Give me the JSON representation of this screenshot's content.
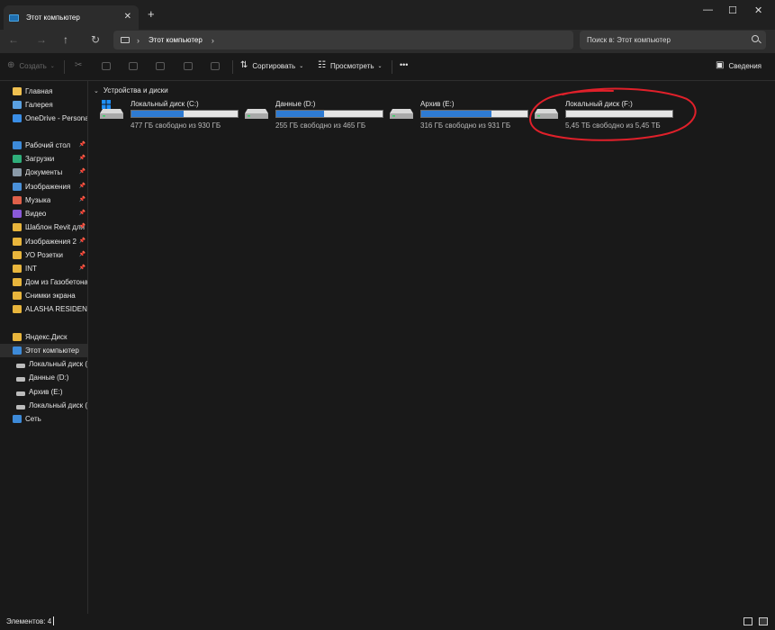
{
  "window": {
    "tab_title": "Этот компьютер",
    "close_tab": "✕",
    "new_tab": "+",
    "minimize": "—",
    "maximize": "☐",
    "close": "✕"
  },
  "address": {
    "back": "←",
    "forward": "→",
    "up": "↑",
    "refresh": "↻",
    "path": "Этот компьютер",
    "search_placeholder": "Поиск в: Этот компьютер"
  },
  "toolbar": {
    "create": "Создать",
    "sort": "Сортировать",
    "view": "Просмотреть",
    "more": "•••",
    "details": "Сведения"
  },
  "sidebar": {
    "items": [
      {
        "label": "Главная",
        "icon": "home-icon",
        "color": "#f0c050",
        "pinned": false
      },
      {
        "label": "Галерея",
        "icon": "gallery-icon",
        "color": "#5aa0e0",
        "pinned": false
      },
      {
        "label": "OneDrive - Personal",
        "icon": "cloud-icon",
        "color": "#3a8ee6",
        "pinned": false
      },
      {
        "label": "Рабочий стол",
        "icon": "desktop-icon",
        "color": "#3d8ad8",
        "pinned": true
      },
      {
        "label": "Загрузки",
        "icon": "download-icon",
        "color": "#2fae7a",
        "pinned": true
      },
      {
        "label": "Документы",
        "icon": "document-icon",
        "color": "#8a9aa8",
        "pinned": true
      },
      {
        "label": "Изображения",
        "icon": "pictures-icon",
        "color": "#4a90d8",
        "pinned": true
      },
      {
        "label": "Музыка",
        "icon": "music-icon",
        "color": "#e0604a",
        "pinned": true
      },
      {
        "label": "Видео",
        "icon": "video-icon",
        "color": "#8a5ad8",
        "pinned": true
      },
      {
        "label": "Шаблон Revit для",
        "icon": "folder-icon",
        "color": "#e8b53c",
        "pinned": true
      },
      {
        "label": "Изображения 2",
        "icon": "folder-icon",
        "color": "#e8b53c",
        "pinned": true
      },
      {
        "label": "УО Розетки",
        "icon": "folder-icon",
        "color": "#e8b53c",
        "pinned": true
      },
      {
        "label": "INT",
        "icon": "folder-icon",
        "color": "#e8b53c",
        "pinned": true
      },
      {
        "label": "Дом из Газобетона",
        "icon": "folder-icon",
        "color": "#e8b53c",
        "pinned": false
      },
      {
        "label": "Снимки экрана",
        "icon": "folder-icon",
        "color": "#e8b53c",
        "pinned": false
      },
      {
        "label": "ALASHA RESIDENSE",
        "icon": "folder-icon",
        "color": "#e8b53c",
        "pinned": false
      },
      {
        "label": "Яндекс.Диск",
        "icon": "folder-icon",
        "color": "#e8b53c",
        "pinned": false
      },
      {
        "label": "Этот компьютер",
        "icon": "computer-icon",
        "color": "#3d8ad8",
        "pinned": false
      },
      {
        "label": "Локальный диск (C",
        "icon": "drive-icon",
        "color": "#bcbcbc",
        "pinned": false
      },
      {
        "label": "Данные (D:)",
        "icon": "drive-icon",
        "color": "#bcbcbc",
        "pinned": false
      },
      {
        "label": "Архив (E:)",
        "icon": "drive-icon",
        "color": "#bcbcbc",
        "pinned": false
      },
      {
        "label": "Локальный диск (F",
        "icon": "drive-icon",
        "color": "#bcbcbc",
        "pinned": false
      },
      {
        "label": "Сеть",
        "icon": "network-icon",
        "color": "#3d8ad8",
        "pinned": false
      }
    ]
  },
  "content": {
    "section_title": "Устройства и диски",
    "drives": [
      {
        "name": "Локальный диск (C:)",
        "free": "477 ГБ свободно из 930 ГБ",
        "used_fraction": 0.49,
        "system": true
      },
      {
        "name": "Данные (D:)",
        "free": "255 ГБ свободно из 465 ГБ",
        "used_fraction": 0.45,
        "system": false
      },
      {
        "name": "Архив (E:)",
        "free": "316 ГБ свободно из 931 ГБ",
        "used_fraction": 0.66,
        "system": false
      },
      {
        "name": "Локальный диск (F:)",
        "free": "5,45 ТБ свободно из 5,45 ТБ",
        "used_fraction": 0.0,
        "system": false
      }
    ]
  },
  "status": {
    "items_count": "Элементов: 4"
  },
  "colors": {
    "accent": "#2e7bd3",
    "annotation": "#e0202a"
  }
}
